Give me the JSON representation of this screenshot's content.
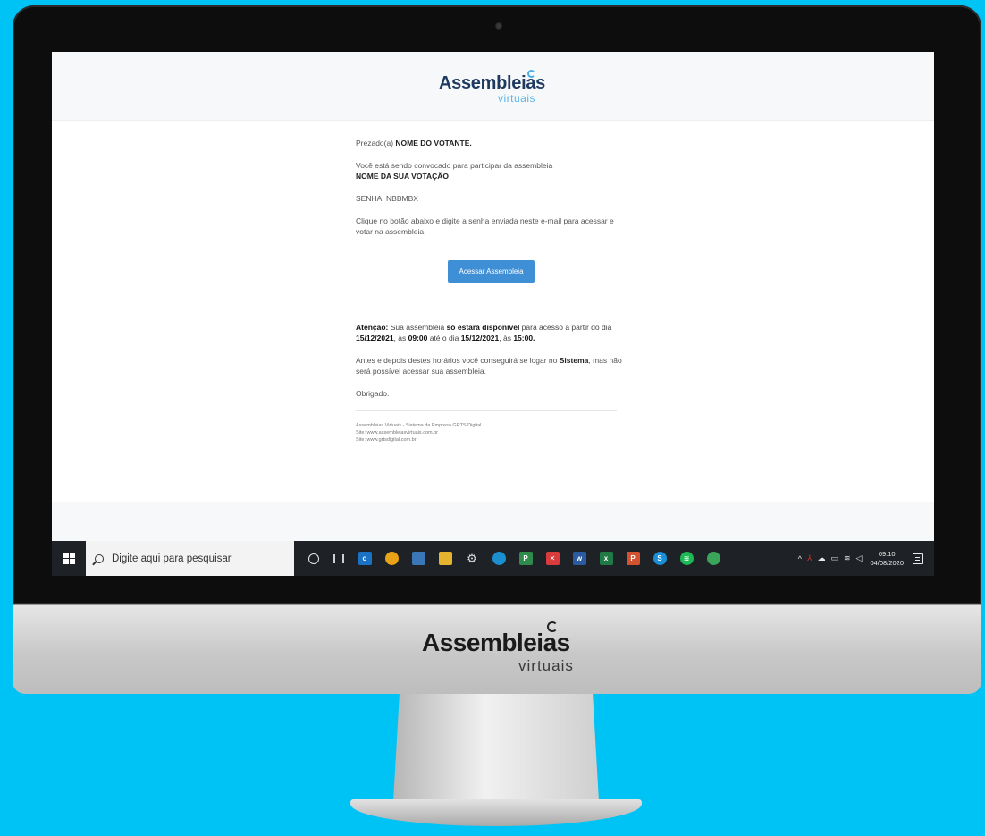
{
  "email": {
    "brand": {
      "name": "Assembleias",
      "sub": "virtuais"
    },
    "greeting_prefix": "Prezado(a) ",
    "greeting_name": "NOME DO VOTANTE.",
    "invite_text": "Você está sendo convocado para participar da assembleia",
    "voting_name": "NOME DA SUA VOTAÇÃO",
    "password": "SENHA: NBBMBX",
    "instruction": "Clique no botão abaixo e digite a senha enviada neste e-mail para acessar e votar na assembleia.",
    "button_label": "Acessar Assembleia",
    "attention": {
      "label": "Atenção:",
      "text_1": " Sua assembleia ",
      "bold_1": "só estará disponível",
      "text_2": " para acesso a partir do dia ",
      "date_start": "15/12/2021",
      "text_3": ", às ",
      "time_start": "09:00",
      "text_4": " até o dia ",
      "date_end": "15/12/2021",
      "text_5": ", às ",
      "time_end": "15:00."
    },
    "note": {
      "text_1": "Antes e depois destes horários você conseguirá se logar no ",
      "bold": "Sistema",
      "text_2": ", mas não será possível acessar sua assembleia."
    },
    "thanks": "Obrigado.",
    "footer": [
      "Assembleias Virtuais - Sistema da Empresa GRTS Digital",
      "Site: www.assembleiasvirtuais.com.br",
      "Site: www.grtsdigital.com.br"
    ]
  },
  "taskbar": {
    "search_placeholder": "Digite aqui para pesquisar",
    "apps": [
      {
        "icon": "outlook-icon",
        "glyph": "o",
        "color": "#1b72c4"
      },
      {
        "icon": "chrome-icon",
        "glyph": "",
        "color": "#e8a317"
      },
      {
        "icon": "calculator-icon",
        "glyph": "",
        "color": "#3a76b8"
      },
      {
        "icon": "file-explorer-icon",
        "glyph": "",
        "color": "#e6b32e"
      },
      {
        "icon": "settings-icon",
        "glyph": "⚙",
        "color": "transparent"
      },
      {
        "icon": "edge-icon",
        "glyph": "",
        "color": "#1b8fd0"
      },
      {
        "icon": "project-icon",
        "glyph": "P",
        "color": "#2f8b4c"
      },
      {
        "icon": "xmind-icon",
        "glyph": "✕",
        "color": "#d83b3b"
      },
      {
        "icon": "word-icon",
        "glyph": "w",
        "color": "#2c5aa0"
      },
      {
        "icon": "excel-icon",
        "glyph": "x",
        "color": "#1f7a45"
      },
      {
        "icon": "powerpoint-icon",
        "glyph": "P",
        "color": "#d35230"
      },
      {
        "icon": "skype-icon",
        "glyph": "S",
        "color": "#1a8fd8"
      },
      {
        "icon": "spotify-icon",
        "glyph": "≋",
        "color": "#1db954"
      },
      {
        "icon": "photos-icon",
        "glyph": "",
        "color": "#3aa55a"
      }
    ],
    "time": "09:10",
    "date": "04/08/2020"
  },
  "chin": {
    "brand": "Assembleias",
    "sub": "virtuais"
  }
}
